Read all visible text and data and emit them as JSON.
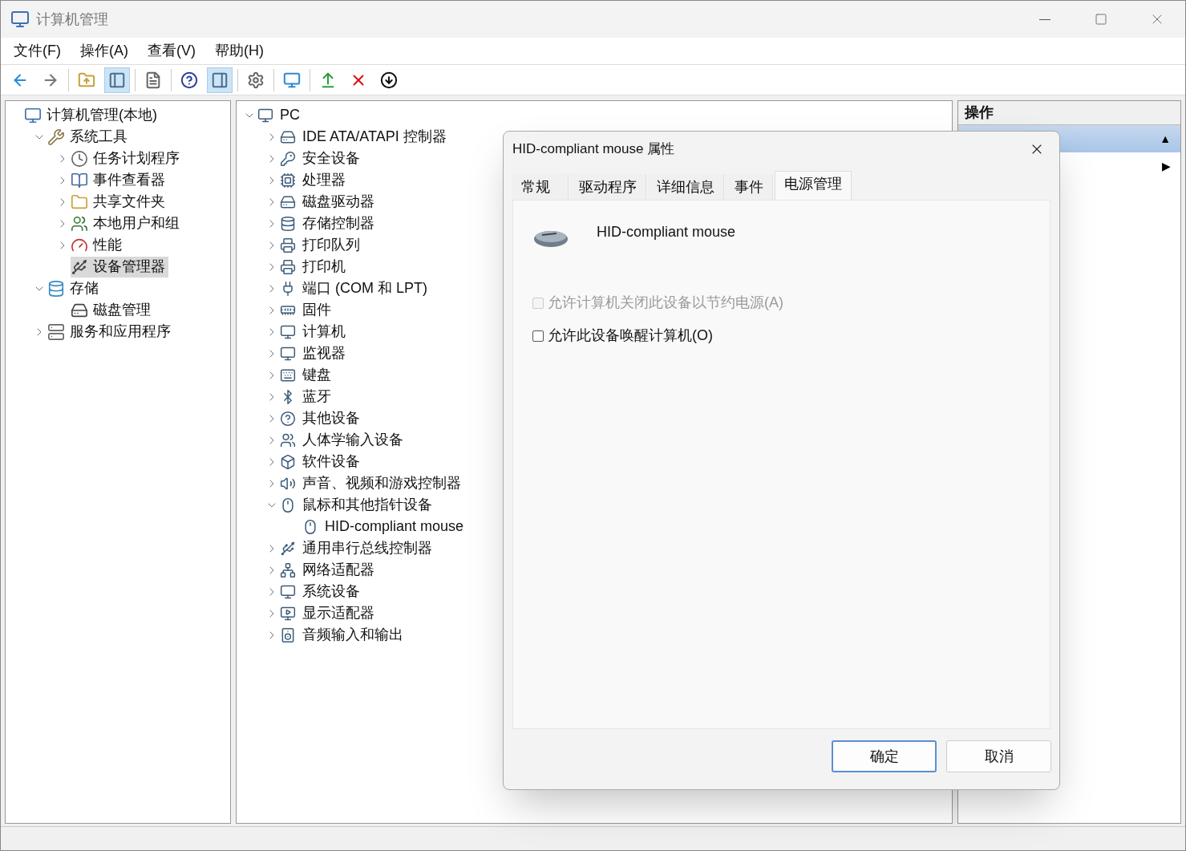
{
  "window": {
    "title": "计算机管理"
  },
  "menu": [
    "文件(F)",
    "操作(A)",
    "查看(V)",
    "帮助(H)"
  ],
  "toolbar": [
    {
      "kind": "back",
      "pressed": false
    },
    {
      "kind": "forward",
      "pressed": false
    },
    {
      "kind": "up",
      "pressed": false
    },
    {
      "kind": "tree",
      "pressed": true
    },
    {
      "kind": "properties",
      "pressed": false
    },
    {
      "kind": "help",
      "pressed": false
    },
    {
      "kind": "pane",
      "pressed": true
    },
    {
      "kind": "update",
      "pressed": false
    },
    {
      "kind": "scan",
      "pressed": false
    },
    {
      "kind": "enable",
      "pressed": false
    },
    {
      "kind": "remove",
      "pressed": false
    },
    {
      "kind": "download",
      "pressed": false
    }
  ],
  "console_tree": [
    {
      "label": "计算机管理(本地)",
      "selected": false,
      "children": [
        {
          "label": "系统工具",
          "expanded": true,
          "selected": false,
          "children": [
            {
              "label": "任务计划程序",
              "expanded": false,
              "selected": false
            },
            {
              "label": "事件查看器",
              "expanded": false,
              "selected": false
            },
            {
              "label": "共享文件夹",
              "expanded": false,
              "selected": false
            },
            {
              "label": "本地用户和组",
              "expanded": false,
              "selected": false
            },
            {
              "label": "性能",
              "expanded": false,
              "selected": false
            },
            {
              "label": "设备管理器",
              "selected": true
            }
          ]
        },
        {
          "label": "存储",
          "expanded": true,
          "selected": false,
          "children": [
            {
              "label": "磁盘管理",
              "selected": false
            }
          ]
        },
        {
          "label": "服务和应用程序",
          "expanded": false,
          "selected": false
        }
      ]
    }
  ],
  "device_tree": {
    "label": "PC",
    "expanded": true,
    "children": [
      {
        "label": "IDE ATA/ATAPI 控制器",
        "expanded": false
      },
      {
        "label": "安全设备",
        "expanded": false
      },
      {
        "label": "处理器",
        "expanded": false
      },
      {
        "label": "磁盘驱动器",
        "expanded": false
      },
      {
        "label": "存储控制器",
        "expanded": false
      },
      {
        "label": "打印队列",
        "expanded": false
      },
      {
        "label": "打印机",
        "expanded": false
      },
      {
        "label": "端口 (COM 和 LPT)",
        "expanded": false
      },
      {
        "label": "固件",
        "expanded": false
      },
      {
        "label": "计算机",
        "expanded": false
      },
      {
        "label": "监视器",
        "expanded": false
      },
      {
        "label": "键盘",
        "expanded": false
      },
      {
        "label": "蓝牙",
        "expanded": false
      },
      {
        "label": "其他设备",
        "expanded": false
      },
      {
        "label": "人体学输入设备",
        "expanded": false
      },
      {
        "label": "软件设备",
        "expanded": false
      },
      {
        "label": "声音、视频和游戏控制器",
        "expanded": false
      },
      {
        "label": "鼠标和其他指针设备",
        "expanded": true,
        "children": [
          {
            "label": "HID-compliant mouse"
          }
        ]
      },
      {
        "label": "通用串行总线控制器",
        "expanded": false
      },
      {
        "label": "网络适配器",
        "expanded": false
      },
      {
        "label": "系统设备",
        "expanded": false
      },
      {
        "label": "显示适配器",
        "expanded": false
      },
      {
        "label": "音频输入和输出",
        "expanded": false
      }
    ]
  },
  "actions": {
    "title": "操作",
    "rows": [
      {
        "glyph": "▲",
        "selected": true
      },
      {
        "glyph": "▶",
        "selected": false
      }
    ]
  },
  "dialog": {
    "title": "HID-compliant mouse 属性",
    "tabs": [
      {
        "label": "常规",
        "selected": false
      },
      {
        "label": "驱动程序",
        "selected": false
      },
      {
        "label": "详细信息",
        "selected": false
      },
      {
        "label": "事件",
        "selected": false
      },
      {
        "label": "电源管理",
        "selected": true
      }
    ],
    "device_name": "HID-compliant mouse",
    "options": [
      {
        "label": "允许计算机关闭此设备以节约电源(A)",
        "checked": false,
        "disabled": true
      },
      {
        "label": "允许此设备唤醒计算机(O)",
        "checked": false,
        "disabled": false
      }
    ],
    "buttons": [
      {
        "label": "确定",
        "default": true
      },
      {
        "label": "取消",
        "default": false
      }
    ]
  }
}
